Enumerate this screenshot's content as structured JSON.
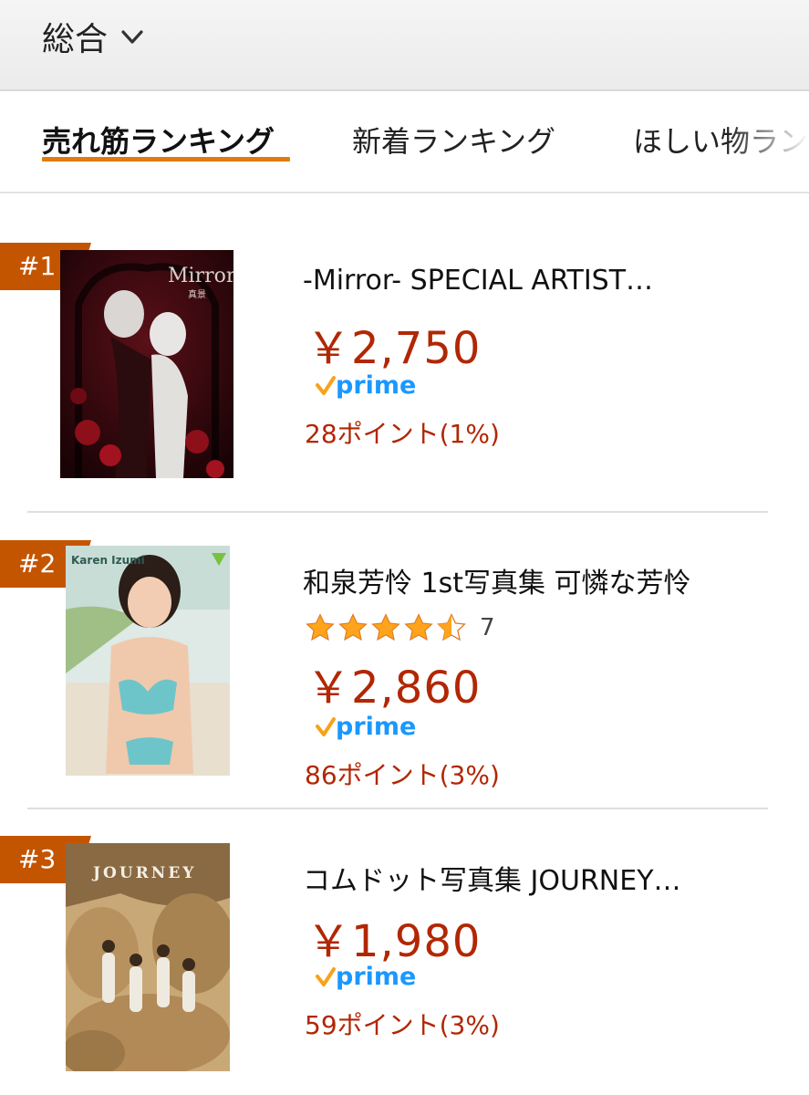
{
  "header": {
    "category_label": "総合",
    "chevron_icon": "chevron-down-icon"
  },
  "tabs": [
    {
      "label": "売れ筋ランキング",
      "active": true
    },
    {
      "label": "新着ランキング",
      "active": false
    },
    {
      "label": "ほしい物ランキング",
      "active": false
    }
  ],
  "items": [
    {
      "rank": "#1",
      "cover_text": "Mirror",
      "cover_subtext": "真景",
      "title": "-Mirror- SPECIAL ARTIST…",
      "price": "￥2,750",
      "prime_text": "prime",
      "points": "28ポイント(1%)"
    },
    {
      "rank": "#2",
      "cover_text": "Karen Izumi",
      "title": "和泉芳怜 1st写真集 可憐な芳怜",
      "rating": 4.5,
      "review_count": "7",
      "price": "￥2,860",
      "prime_text": "prime",
      "points": "86ポイント(3%)"
    },
    {
      "rank": "#3",
      "cover_text": "JOURNEY",
      "title": "コムドット写真集 JOURNEY…",
      "price": "￥1,980",
      "prime_text": "prime",
      "points": "59ポイント(3%)"
    }
  ],
  "colors": {
    "accent": "#e47911",
    "price": "#b12704",
    "badge": "#c45500",
    "prime": "#1a98ff",
    "star": "#ffa41c"
  }
}
